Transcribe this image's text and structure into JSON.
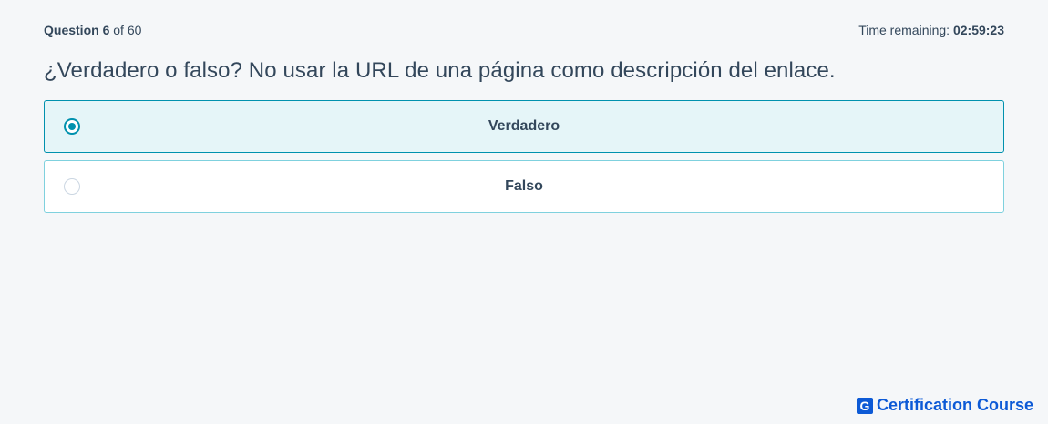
{
  "header": {
    "question_label": "Question",
    "question_number": "6",
    "question_of": "of",
    "question_total": "60",
    "time_label": "Time remaining:",
    "time_value": "02:59:23"
  },
  "question": {
    "text": "¿Verdadero o falso? No usar la URL de una página como descripción del enlace."
  },
  "options": [
    {
      "label": "Verdadero",
      "selected": true
    },
    {
      "label": "Falso",
      "selected": false
    }
  ],
  "brand": {
    "logo_letter": "G",
    "name": "Certification Course",
    "color": "#0d5ad6"
  },
  "colors": {
    "accent": "#0091ae",
    "selected_bg": "#e5f5f8",
    "background": "#f5f7f9"
  }
}
